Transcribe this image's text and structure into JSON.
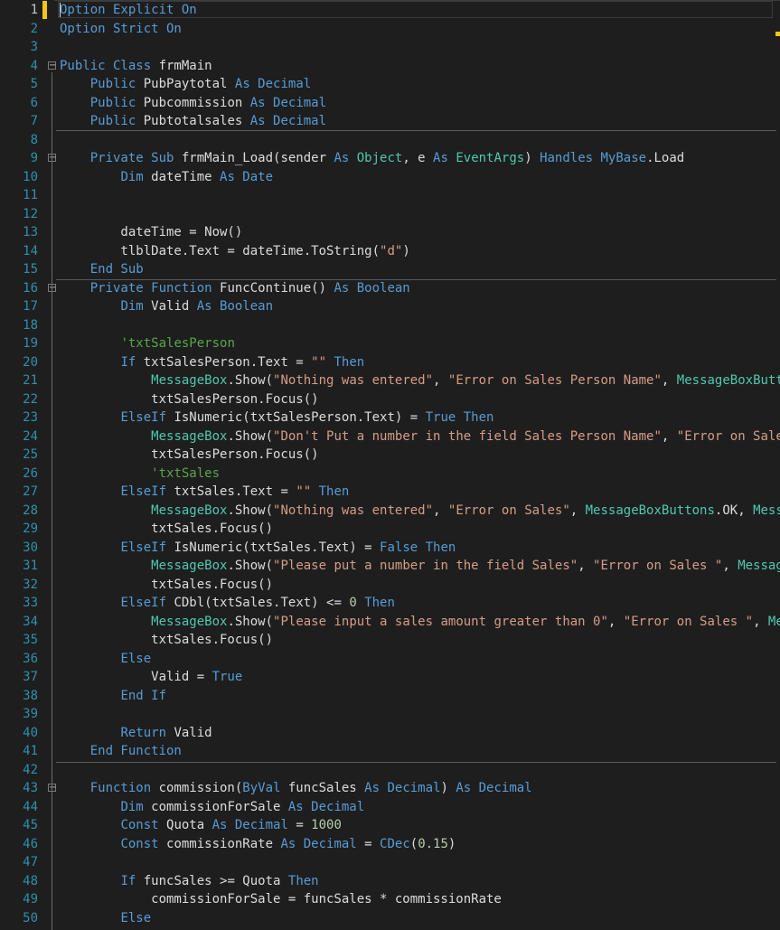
{
  "colors": {
    "background": "#1e1e1e",
    "default": "#dcdcdc",
    "keyword": "#569cd6",
    "type": "#4ec9b0",
    "string": "#d69d85",
    "comment": "#57a64a",
    "number": "#b5cea8",
    "line_number": "#2b91af",
    "change_bar": "#f2c811"
  },
  "editor": {
    "current_line": 1,
    "lines": [
      {
        "n": "1",
        "fold": false,
        "tokens": [
          [
            "kw",
            "Option Explicit On"
          ]
        ]
      },
      {
        "n": "2",
        "fold": false,
        "tokens": [
          [
            "kw",
            "Option Strict On"
          ]
        ]
      },
      {
        "n": "3",
        "fold": false,
        "tokens": []
      },
      {
        "n": "4",
        "fold": true,
        "tokens": [
          [
            "kw",
            "Public Class "
          ],
          [
            "id",
            "frmMain"
          ]
        ]
      },
      {
        "n": "5",
        "fold": false,
        "tokens": [
          [
            "id",
            "    "
          ],
          [
            "kw",
            "Public "
          ],
          [
            "id",
            "PubPaytotal "
          ],
          [
            "kw",
            "As Decimal"
          ]
        ]
      },
      {
        "n": "6",
        "fold": false,
        "tokens": [
          [
            "id",
            "    "
          ],
          [
            "kw",
            "Public "
          ],
          [
            "id",
            "Pubcommission "
          ],
          [
            "kw",
            "As Decimal"
          ]
        ]
      },
      {
        "n": "7",
        "fold": false,
        "tokens": [
          [
            "id",
            "    "
          ],
          [
            "kw",
            "Public "
          ],
          [
            "id",
            "Pubtotalsales "
          ],
          [
            "kw",
            "As Decimal"
          ]
        ]
      },
      {
        "n": "8",
        "fold": false,
        "tokens": []
      },
      {
        "n": "9",
        "fold": true,
        "tokens": [
          [
            "id",
            "    "
          ],
          [
            "kw",
            "Private Sub "
          ],
          [
            "id",
            "frmMain_Load(sender "
          ],
          [
            "kw",
            "As "
          ],
          [
            "ty",
            "Object"
          ],
          [
            "id",
            ", e "
          ],
          [
            "kw",
            "As "
          ],
          [
            "ty",
            "EventArgs"
          ],
          [
            "id",
            ") "
          ],
          [
            "kw",
            "Handles MyBase"
          ],
          [
            "id",
            ".Load"
          ]
        ]
      },
      {
        "n": "10",
        "fold": false,
        "tokens": [
          [
            "id",
            "        "
          ],
          [
            "kw",
            "Dim "
          ],
          [
            "id",
            "dateTime "
          ],
          [
            "kw",
            "As Date"
          ]
        ]
      },
      {
        "n": "11",
        "fold": false,
        "tokens": []
      },
      {
        "n": "12",
        "fold": false,
        "tokens": []
      },
      {
        "n": "13",
        "fold": false,
        "tokens": [
          [
            "id",
            "        dateTime = Now()"
          ]
        ]
      },
      {
        "n": "14",
        "fold": false,
        "tokens": [
          [
            "id",
            "        tlblDate.Text = dateTime.ToString("
          ],
          [
            "str",
            "\"d\""
          ],
          [
            "id",
            ")"
          ]
        ]
      },
      {
        "n": "15",
        "fold": false,
        "tokens": [
          [
            "id",
            "    "
          ],
          [
            "kw",
            "End Sub"
          ]
        ]
      },
      {
        "n": "16",
        "fold": true,
        "tokens": [
          [
            "id",
            "    "
          ],
          [
            "kw",
            "Private Function "
          ],
          [
            "id",
            "FuncContinue() "
          ],
          [
            "kw",
            "As Boolean"
          ]
        ]
      },
      {
        "n": "17",
        "fold": false,
        "tokens": [
          [
            "id",
            "        "
          ],
          [
            "kw",
            "Dim "
          ],
          [
            "id",
            "Valid "
          ],
          [
            "kw",
            "As Boolean"
          ]
        ]
      },
      {
        "n": "18",
        "fold": false,
        "tokens": []
      },
      {
        "n": "19",
        "fold": false,
        "tokens": [
          [
            "id",
            "        "
          ],
          [
            "cm",
            "'txtSalesPerson"
          ]
        ]
      },
      {
        "n": "20",
        "fold": false,
        "tokens": [
          [
            "id",
            "        "
          ],
          [
            "kw",
            "If "
          ],
          [
            "id",
            "txtSalesPerson.Text = "
          ],
          [
            "str",
            "\"\""
          ],
          [
            "kw",
            " Then"
          ]
        ]
      },
      {
        "n": "21",
        "fold": false,
        "tokens": [
          [
            "id",
            "            "
          ],
          [
            "ty",
            "MessageBox"
          ],
          [
            "id",
            ".Show("
          ],
          [
            "str",
            "\"Nothing was entered\""
          ],
          [
            "id",
            ", "
          ],
          [
            "str",
            "\"Error on Sales Person Name\""
          ],
          [
            "id",
            ", "
          ],
          [
            "ty",
            "MessageBoxButtons"
          ]
        ]
      },
      {
        "n": "22",
        "fold": false,
        "tokens": [
          [
            "id",
            "            txtSalesPerson.Focus()"
          ]
        ]
      },
      {
        "n": "23",
        "fold": false,
        "tokens": [
          [
            "id",
            "        "
          ],
          [
            "kw",
            "ElseIf "
          ],
          [
            "id",
            "IsNumeric(txtSalesPerson.Text) = "
          ],
          [
            "kw",
            "True Then"
          ]
        ]
      },
      {
        "n": "24",
        "fold": false,
        "tokens": [
          [
            "id",
            "            "
          ],
          [
            "ty",
            "MessageBox"
          ],
          [
            "id",
            ".Show("
          ],
          [
            "str",
            "\"Don't Put a number in the field Sales Person Name\""
          ],
          [
            "id",
            ", "
          ],
          [
            "str",
            "\"Error on Sales Person Name\""
          ]
        ]
      },
      {
        "n": "25",
        "fold": false,
        "tokens": [
          [
            "id",
            "            txtSalesPerson.Focus()"
          ]
        ]
      },
      {
        "n": "26",
        "fold": false,
        "tokens": [
          [
            "id",
            "            "
          ],
          [
            "cm",
            "'txtSales"
          ]
        ]
      },
      {
        "n": "27",
        "fold": false,
        "tokens": [
          [
            "id",
            "        "
          ],
          [
            "kw",
            "ElseIf "
          ],
          [
            "id",
            "txtSales.Text = "
          ],
          [
            "str",
            "\"\""
          ],
          [
            "kw",
            " Then"
          ]
        ]
      },
      {
        "n": "28",
        "fold": false,
        "tokens": [
          [
            "id",
            "            "
          ],
          [
            "ty",
            "MessageBox"
          ],
          [
            "id",
            ".Show("
          ],
          [
            "str",
            "\"Nothing was entered\""
          ],
          [
            "id",
            ", "
          ],
          [
            "str",
            "\"Error on Sales\""
          ],
          [
            "id",
            ", "
          ],
          [
            "ty",
            "MessageBoxButtons"
          ],
          [
            "id",
            ".OK, "
          ],
          [
            "ty",
            "MessageBoxIcon"
          ]
        ]
      },
      {
        "n": "29",
        "fold": false,
        "tokens": [
          [
            "id",
            "            txtSales.Focus()"
          ]
        ]
      },
      {
        "n": "30",
        "fold": false,
        "tokens": [
          [
            "id",
            "        "
          ],
          [
            "kw",
            "ElseIf "
          ],
          [
            "id",
            "IsNumeric(txtSales.Text) = "
          ],
          [
            "kw",
            "False Then"
          ]
        ]
      },
      {
        "n": "31",
        "fold": false,
        "tokens": [
          [
            "id",
            "            "
          ],
          [
            "ty",
            "MessageBox"
          ],
          [
            "id",
            ".Show("
          ],
          [
            "str",
            "\"Please put a number in the field Sales\""
          ],
          [
            "id",
            ", "
          ],
          [
            "str",
            "\"Error on Sales \""
          ],
          [
            "id",
            ", "
          ],
          [
            "ty",
            "MessageBoxButtons"
          ]
        ]
      },
      {
        "n": "32",
        "fold": false,
        "tokens": [
          [
            "id",
            "            txtSales.Focus()"
          ]
        ]
      },
      {
        "n": "33",
        "fold": false,
        "tokens": [
          [
            "id",
            "        "
          ],
          [
            "kw",
            "ElseIf "
          ],
          [
            "id",
            "CDbl(txtSales.Text) <= "
          ],
          [
            "num",
            "0"
          ],
          [
            "kw",
            " Then"
          ]
        ]
      },
      {
        "n": "34",
        "fold": false,
        "tokens": [
          [
            "id",
            "            "
          ],
          [
            "ty",
            "MessageBox"
          ],
          [
            "id",
            ".Show("
          ],
          [
            "str",
            "\"Please input a sales amount greater than 0\""
          ],
          [
            "id",
            ", "
          ],
          [
            "str",
            "\"Error on Sales \""
          ],
          [
            "id",
            ", "
          ],
          [
            "ty",
            "MessageBoxButtons"
          ]
        ]
      },
      {
        "n": "35",
        "fold": false,
        "tokens": [
          [
            "id",
            "            txtSales.Focus()"
          ]
        ]
      },
      {
        "n": "36",
        "fold": false,
        "tokens": [
          [
            "id",
            "        "
          ],
          [
            "kw",
            "Else"
          ]
        ]
      },
      {
        "n": "37",
        "fold": false,
        "tokens": [
          [
            "id",
            "            Valid = "
          ],
          [
            "kw",
            "True"
          ]
        ]
      },
      {
        "n": "38",
        "fold": false,
        "tokens": [
          [
            "id",
            "        "
          ],
          [
            "kw",
            "End If"
          ]
        ]
      },
      {
        "n": "39",
        "fold": false,
        "tokens": []
      },
      {
        "n": "40",
        "fold": false,
        "tokens": [
          [
            "id",
            "        "
          ],
          [
            "kw",
            "Return "
          ],
          [
            "id",
            "Valid"
          ]
        ]
      },
      {
        "n": "41",
        "fold": false,
        "tokens": [
          [
            "id",
            "    "
          ],
          [
            "kw",
            "End Function"
          ]
        ]
      },
      {
        "n": "42",
        "fold": false,
        "tokens": []
      },
      {
        "n": "43",
        "fold": true,
        "tokens": [
          [
            "id",
            "    "
          ],
          [
            "kw",
            "Function "
          ],
          [
            "id",
            "commission("
          ],
          [
            "kw",
            "ByVal "
          ],
          [
            "id",
            "funcSales "
          ],
          [
            "kw",
            "As Decimal"
          ],
          [
            "id",
            ") "
          ],
          [
            "kw",
            "As Decimal"
          ]
        ]
      },
      {
        "n": "44",
        "fold": false,
        "tokens": [
          [
            "id",
            "        "
          ],
          [
            "kw",
            "Dim "
          ],
          [
            "id",
            "commissionForSale "
          ],
          [
            "kw",
            "As Decimal"
          ]
        ]
      },
      {
        "n": "45",
        "fold": false,
        "tokens": [
          [
            "id",
            "        "
          ],
          [
            "kw",
            "Const "
          ],
          [
            "id",
            "Quota "
          ],
          [
            "kw",
            "As Decimal "
          ],
          [
            "id",
            "= "
          ],
          [
            "num",
            "1000"
          ]
        ]
      },
      {
        "n": "46",
        "fold": false,
        "tokens": [
          [
            "id",
            "        "
          ],
          [
            "kw",
            "Const "
          ],
          [
            "id",
            "commissionRate "
          ],
          [
            "kw",
            "As Decimal "
          ],
          [
            "id",
            "= "
          ],
          [
            "kw",
            "CDec"
          ],
          [
            "id",
            "("
          ],
          [
            "num",
            "0.15"
          ],
          [
            "id",
            ")"
          ]
        ]
      },
      {
        "n": "47",
        "fold": false,
        "tokens": []
      },
      {
        "n": "48",
        "fold": false,
        "tokens": [
          [
            "id",
            "        "
          ],
          [
            "kw",
            "If "
          ],
          [
            "id",
            "funcSales >= Quota "
          ],
          [
            "kw",
            "Then"
          ]
        ]
      },
      {
        "n": "49",
        "fold": false,
        "tokens": [
          [
            "id",
            "            commissionForSale = funcSales * commissionRate"
          ]
        ]
      },
      {
        "n": "50",
        "fold": false,
        "tokens": [
          [
            "id",
            "        "
          ],
          [
            "kw",
            "Else"
          ]
        ]
      }
    ]
  }
}
